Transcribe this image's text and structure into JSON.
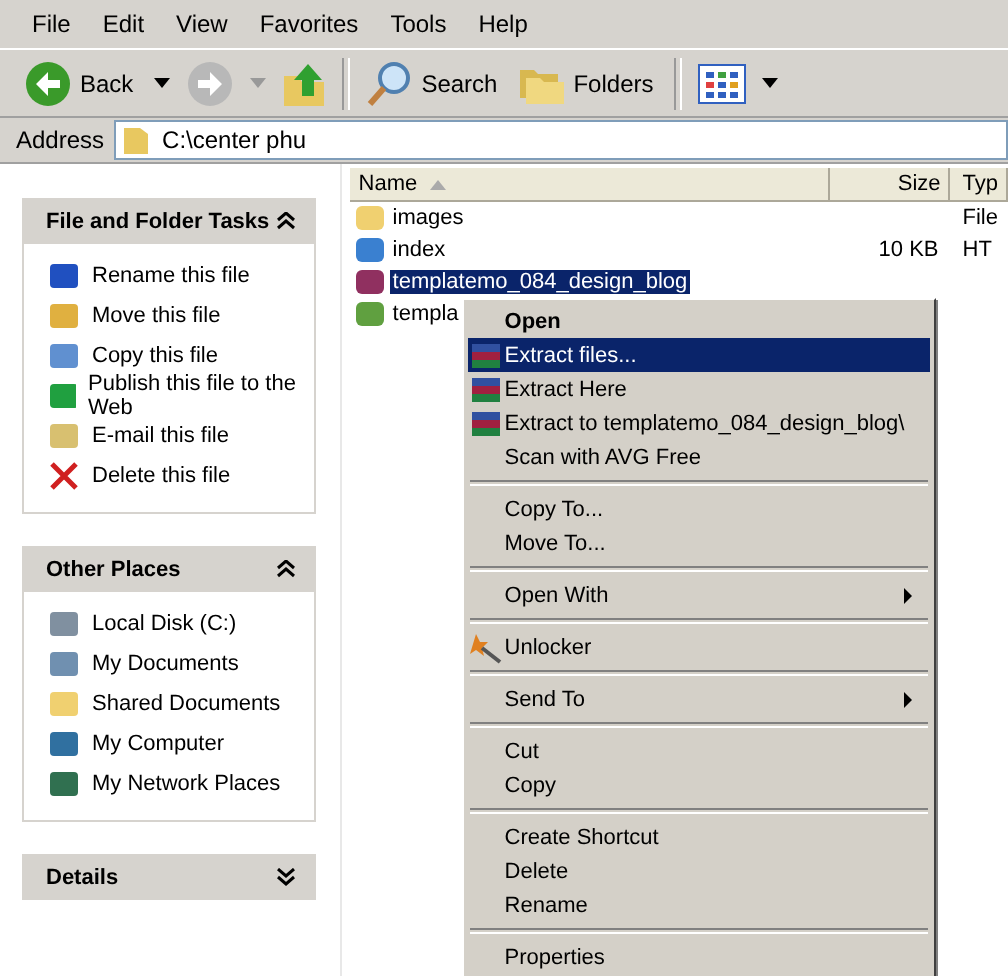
{
  "menu_bar": [
    "File",
    "Edit",
    "View",
    "Favorites",
    "Tools",
    "Help"
  ],
  "toolbar": {
    "back": "Back",
    "search": "Search",
    "folders": "Folders"
  },
  "address": {
    "label": "Address",
    "value": "C:\\center phu"
  },
  "task_panels": [
    {
      "title": "File and Folder Tasks",
      "expanded": true,
      "items": [
        {
          "label": "Rename this file"
        },
        {
          "label": "Move this file"
        },
        {
          "label": "Copy this file"
        },
        {
          "label": "Publish this file to the Web"
        },
        {
          "label": "E-mail this file"
        },
        {
          "label": "Delete this file"
        }
      ]
    },
    {
      "title": "Other Places",
      "expanded": true,
      "items": [
        {
          "label": "Local Disk (C:)"
        },
        {
          "label": "My Documents"
        },
        {
          "label": "Shared Documents"
        },
        {
          "label": "My Computer"
        },
        {
          "label": "My Network Places"
        }
      ]
    },
    {
      "title": "Details",
      "expanded": false
    }
  ],
  "file_list": {
    "columns": [
      "Name",
      "Size",
      "Typ"
    ],
    "rows": [
      {
        "name": "images",
        "type": "File",
        "selected": false
      },
      {
        "name": "index",
        "size": "10 KB",
        "type": "HT",
        "selected": false
      },
      {
        "name": "templatemo_084_design_blog",
        "selected": true
      },
      {
        "name": "templa",
        "selected": false
      }
    ]
  },
  "context_menu": [
    {
      "kind": "default",
      "label": "Open",
      "selected": false
    },
    {
      "kind": "item",
      "label": "Extract files...",
      "selected": true
    },
    {
      "kind": "item",
      "label": "Extract Here",
      "selected": false
    },
    {
      "kind": "item",
      "label": "Extract to templatemo_084_design_blog\\",
      "selected": false
    },
    {
      "kind": "item",
      "label": "Scan with AVG Free",
      "selected": false
    },
    {
      "kind": "separator"
    },
    {
      "kind": "item",
      "label": "Copy To...",
      "selected": false
    },
    {
      "kind": "item",
      "label": "Move To...",
      "selected": false
    },
    {
      "kind": "separator"
    },
    {
      "kind": "submenu",
      "label": "Open With",
      "selected": false
    },
    {
      "kind": "separator"
    },
    {
      "kind": "item",
      "label": "Unlocker",
      "selected": false
    },
    {
      "kind": "separator"
    },
    {
      "kind": "submenu",
      "label": "Send To",
      "selected": false
    },
    {
      "kind": "separator"
    },
    {
      "kind": "item",
      "label": "Cut",
      "selected": false
    },
    {
      "kind": "item",
      "label": "Copy",
      "selected": false
    },
    {
      "kind": "separator"
    },
    {
      "kind": "item",
      "label": "Create Shortcut",
      "selected": false
    },
    {
      "kind": "item",
      "label": "Delete",
      "selected": false
    },
    {
      "kind": "item",
      "label": "Rename",
      "selected": false
    },
    {
      "kind": "separator"
    },
    {
      "kind": "item",
      "label": "Properties",
      "selected": false
    }
  ]
}
